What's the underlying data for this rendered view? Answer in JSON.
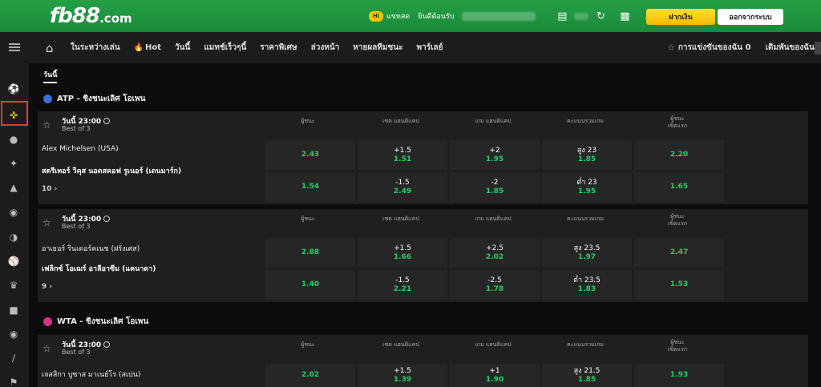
{
  "header": {
    "logo_main": "fb88",
    "logo_suffix": ".com",
    "chat_badge": "Hi",
    "chat_label": "แชทสด",
    "welcome_label": "ยินดีต้อนรับ",
    "deposit_button": "ฝากเงิน",
    "logout_button": "ออกจากระบบ"
  },
  "nav": {
    "items": [
      {
        "label": "ในระหว่างเล่น"
      },
      {
        "label": "Hot",
        "hot": true
      },
      {
        "label": "วันนี้"
      },
      {
        "label": "แมทช์เร็วๆนี้"
      },
      {
        "label": "ราคาพิเศษ"
      },
      {
        "label": "ล่วงหน้า"
      },
      {
        "label": "หายผลทีมชนะ"
      },
      {
        "label": "พาร์เลย์"
      }
    ],
    "my_competitions": "การแข่งขันของฉัน 0",
    "my_bets": "เดิมพันของฉัน 0"
  },
  "content": {
    "date_tab": "วันนี้",
    "leagues": [
      {
        "name": "ATP - ชิงชนะเลิศ โอเพน",
        "flag_color": "#3b6fd8"
      },
      {
        "name": "WTA - ชิงชนะเลิศ โอเพน",
        "flag_color": "#d8318a"
      }
    ],
    "columns": [
      "ผู้ชนะ",
      "เซต แฮนดิแคป",
      "เกม แฮนดิแคป",
      "คะแนนรวมเกม",
      "ผู้ชนะ\nเซ็ตแรก"
    ],
    "matches": [
      {
        "time": "วันนี้ 23:00",
        "best_of": "Best of 3",
        "team1": "Alex Michelsen (USA)",
        "team2": "สตรีเทอร์ วิคุส นอดสคอฟ รูเนอร์ (เดนมาร์ก)",
        "more": "10",
        "row1": [
          {
            "hcap": "",
            "odds": "2.43"
          },
          {
            "hcap": "+1.5",
            "odds": "1.51"
          },
          {
            "hcap": "+2",
            "odds": "1.95"
          },
          {
            "hcap": "สูง 23",
            "odds": "1.85"
          },
          {
            "hcap": "",
            "odds": "2.20"
          }
        ],
        "row2": [
          {
            "hcap": "",
            "odds": "1.54"
          },
          {
            "hcap": "-1.5",
            "odds": "2.49"
          },
          {
            "hcap": "-2",
            "odds": "1.85"
          },
          {
            "hcap": "ต่ำ 23",
            "odds": "1.95"
          },
          {
            "hcap": "",
            "odds": "1.65"
          }
        ]
      },
      {
        "time": "วันนี้ 23:00",
        "best_of": "Best of 3",
        "team1": "อาเธอร์ รินเดอร์คเนช (ฝรั่งเศส)",
        "team2": "เฟลิกซ์ โอเฌร์ อาลีอาซีม (แคนาดา)",
        "more": "9",
        "row1": [
          {
            "hcap": "",
            "odds": "2.88"
          },
          {
            "hcap": "+1.5",
            "odds": "1.66"
          },
          {
            "hcap": "+2.5",
            "odds": "2.02"
          },
          {
            "hcap": "สูง 23.5",
            "odds": "1.97"
          },
          {
            "hcap": "",
            "odds": "2.47"
          }
        ],
        "row2": [
          {
            "hcap": "",
            "odds": "1.40"
          },
          {
            "hcap": "-1.5",
            "odds": "2.21"
          },
          {
            "hcap": "-2.5",
            "odds": "1.78"
          },
          {
            "hcap": "ต่ำ 23.5",
            "odds": "1.83"
          },
          {
            "hcap": "",
            "odds": "1.53"
          }
        ]
      },
      {
        "time": "วันนี้ 23:00",
        "best_of": "Best of 3",
        "team1": "เจสสิกา บูซาส มาเนย์โร (สเปน)",
        "row1": [
          {
            "hcap": "",
            "odds": "2.02"
          },
          {
            "hcap": "+1.5",
            "odds": "1.39"
          },
          {
            "hcap": "+1",
            "odds": "1.90"
          },
          {
            "hcap": "สูง 21.5",
            "odds": "1.85"
          },
          {
            "hcap": "",
            "odds": "1.93"
          }
        ]
      }
    ]
  }
}
